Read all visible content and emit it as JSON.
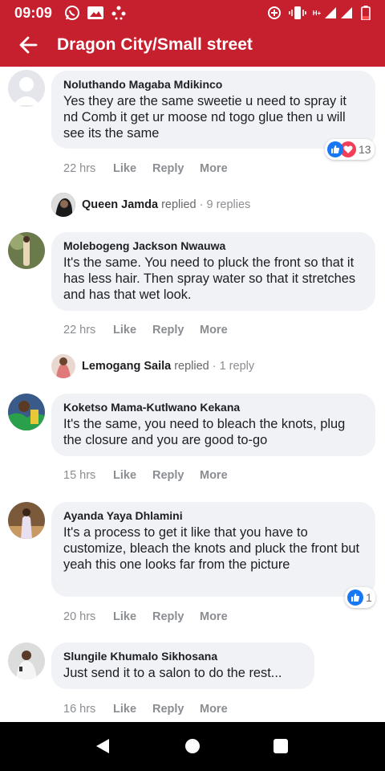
{
  "status_bar": {
    "time": "09:09",
    "network_label": "H+",
    "icons": [
      "whatsapp-icon",
      "gallery-icon",
      "dots-icon",
      "data-saver-icon",
      "vibrate-icon",
      "network-type-icon",
      "signal-icon",
      "signal-icon",
      "battery-low-icon"
    ]
  },
  "header": {
    "title": "Dragon City/Small street",
    "background": "#c6202f"
  },
  "comments": [
    {
      "author": "Noluthando Magaba Mdikinco",
      "text": "Yes they are the same sweetie u need to spray it nd Comb it get ur moose nd togo glue then u will see its the same",
      "time": "22 hrs",
      "reaction_count": "13",
      "reactions": [
        "like-icon",
        "love-icon"
      ]
    },
    {
      "author": "Molebogeng Jackson Nwauwa",
      "text": "It's the same. You need to pluck the front so that it has less hair. Then spray water so that it stretches and has that wet look.",
      "time": "22 hrs"
    },
    {
      "author": "Koketso Mama-Kutlwano Kekana",
      "text": "It's the same, you need to bleach the knots, plug the closure and you are good to-go",
      "time": "15 hrs"
    },
    {
      "author": "Ayanda Yaya Dhlamini",
      "text": "It's a process to get it like that you have to customize, bleach the knots and pluck the front but yeah this one looks far from the picture",
      "time": "20 hrs",
      "reaction_count": "1",
      "reactions": [
        "like-icon"
      ]
    },
    {
      "author": "Slungile Khumalo Sikhosana",
      "text": "Just send it to a salon to do the rest...",
      "time": "16 hrs"
    }
  ],
  "replies": [
    {
      "name": "Queen Jamda",
      "word": "replied",
      "count": "· 9 replies"
    },
    {
      "name": "Lemogang Saila",
      "word": "replied",
      "count": "· 1 reply"
    }
  ],
  "actions": {
    "like": "Like",
    "reply": "Reply",
    "more": "More"
  },
  "colors": {
    "bubble": "#f0f2f5",
    "like": "#1877f2",
    "love": "#f33e58",
    "muted": "#8a8d91"
  },
  "nav": {
    "back": "back-triangle-icon",
    "home": "home-circle-icon",
    "recents": "recents-square-icon"
  }
}
